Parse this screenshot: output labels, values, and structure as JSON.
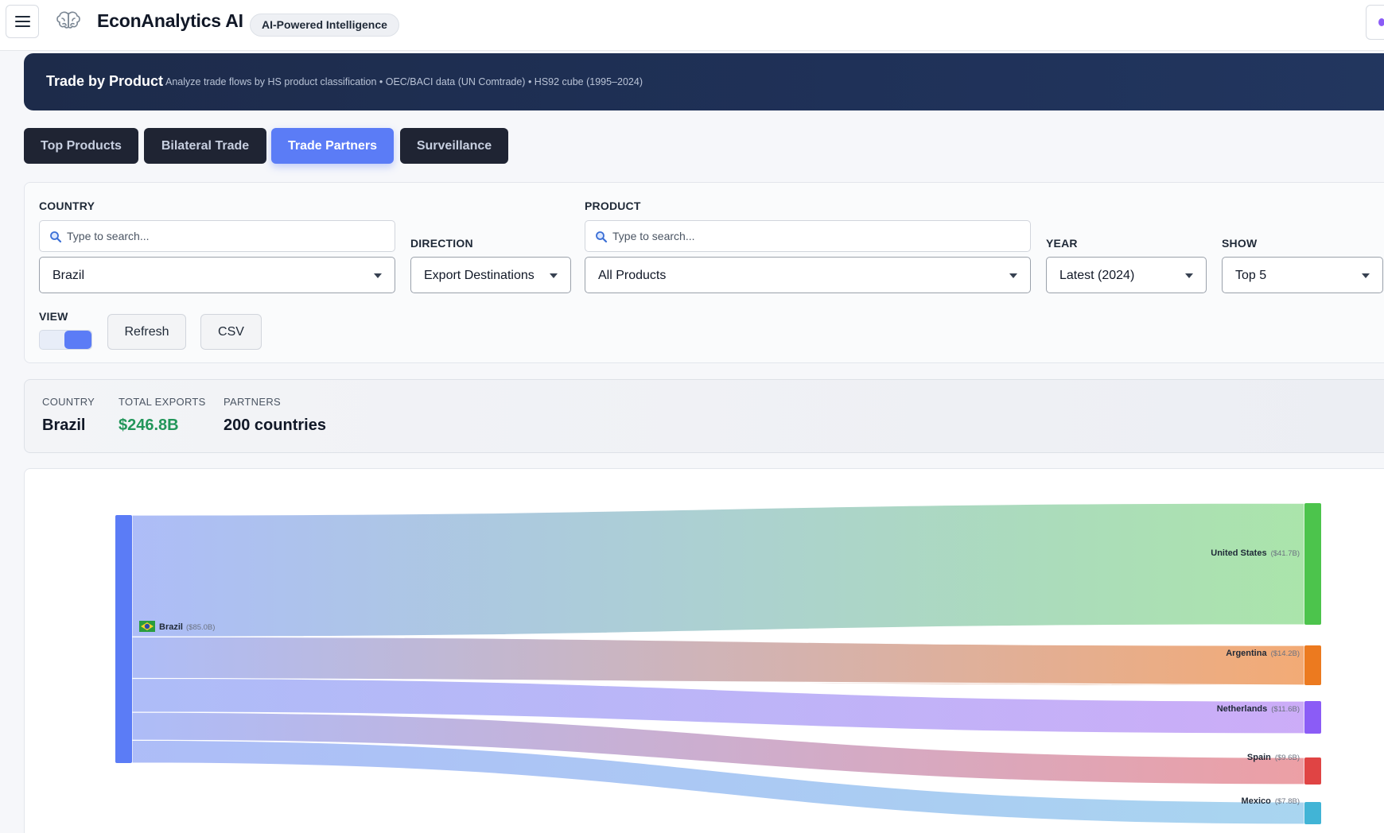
{
  "app": {
    "title": "EconAnalytics AI",
    "badge": "AI-Powered Intelligence"
  },
  "banner": {
    "title": "Trade by Product",
    "subtitle": "Analyze trade flows by HS product classification • OEC/BACI data (UN Comtrade) • HS92 cube (1995–2024)"
  },
  "tabs": [
    {
      "label": "Top Products",
      "active": false
    },
    {
      "label": "Bilateral Trade",
      "active": false
    },
    {
      "label": "Trade Partners",
      "active": true
    },
    {
      "label": "Surveillance",
      "active": false
    }
  ],
  "filters": {
    "country": {
      "label": "COUNTRY",
      "placeholder": "Type to search...",
      "value": "Brazil"
    },
    "direction": {
      "label": "DIRECTION",
      "value": "Export Destinations"
    },
    "product": {
      "label": "PRODUCT",
      "placeholder": "Type to search...",
      "value": "All Products"
    },
    "year": {
      "label": "YEAR",
      "value": "Latest (2024)"
    },
    "show": {
      "label": "SHOW",
      "value": "Top 5"
    },
    "view": {
      "label": "VIEW"
    },
    "refresh_label": "Refresh",
    "csv_label": "CSV"
  },
  "summary": {
    "country_label": "COUNTRY",
    "country_value": "Brazil",
    "total_label": "TOTAL EXPORTS",
    "total_value": "$246.8B",
    "partners_label": "PARTNERS",
    "partners_value": "200 countries"
  },
  "chart_data": {
    "type": "sankey",
    "source": {
      "name": "Brazil",
      "value_label": "($85.0B)",
      "value": 85.0,
      "color": "#5b7cf6"
    },
    "targets": [
      {
        "name": "United States",
        "value_label": "($41.7B)",
        "value": 41.7,
        "color": "#4cc44c"
      },
      {
        "name": "Argentina",
        "value_label": "($14.2B)",
        "value": 14.2,
        "color": "#ec7a1f"
      },
      {
        "name": "Netherlands",
        "value_label": "($11.6B)",
        "value": 11.6,
        "color": "#8b5cf6"
      },
      {
        "name": "Spain",
        "value_label": "($9.6B)",
        "value": 9.6,
        "color": "#e04444"
      },
      {
        "name": "Mexico",
        "value_label": "($7.8B)",
        "value": 7.8,
        "color": "#41b4d6"
      }
    ],
    "colors": {
      "flow_start": "#a9b9f7",
      "us_end": "#a6e3a6",
      "ar_end": "#f2a66e",
      "nl_end": "#c9a8f7",
      "es_end": "#eb9aa0",
      "mx_end": "#a4d3ef"
    }
  }
}
